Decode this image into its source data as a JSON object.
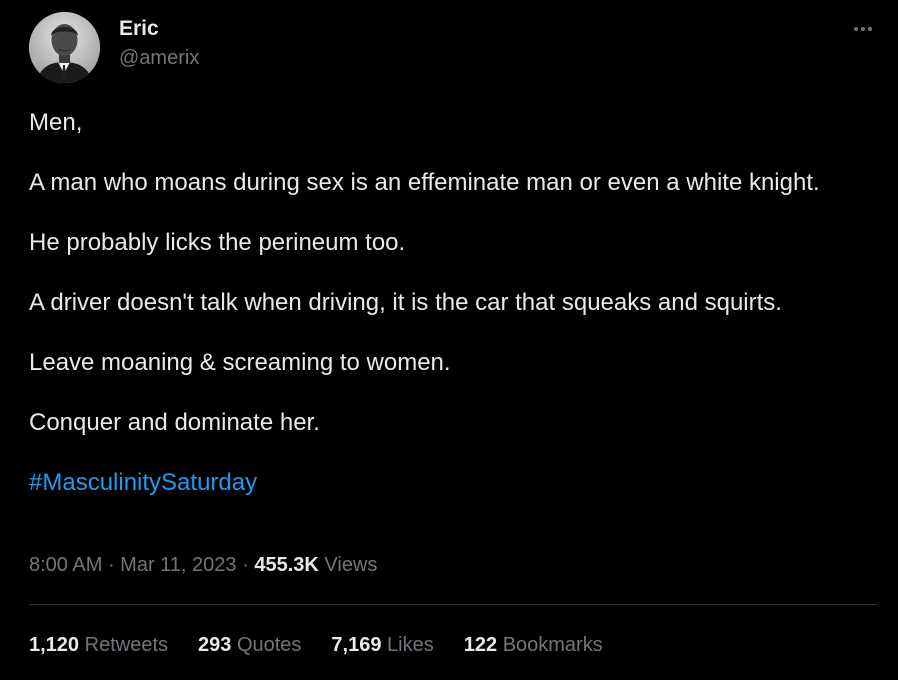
{
  "tweet": {
    "author": {
      "name": "Eric",
      "handle": "@amerix"
    },
    "paragraphs": [
      "Men,",
      "A man who moans during sex is an effeminate man or even a white knight.",
      "He probably licks the perineum too.",
      "A driver doesn't talk when driving, it is the car that squeaks and squirts.",
      "Leave moaning & screaming to women.",
      "Conquer and dominate her."
    ],
    "hashtag": "#MasculinitySaturday",
    "time": "8:00 AM",
    "separator": " · ",
    "date": "Mar 11, 2023",
    "views_count": "455.3K",
    "views_label": "Views"
  },
  "stats": [
    {
      "count": "1,120",
      "label": "Retweets"
    },
    {
      "count": "293",
      "label": "Quotes"
    },
    {
      "count": "7,169",
      "label": "Likes"
    },
    {
      "count": "122",
      "label": "Bookmarks"
    }
  ],
  "colors": {
    "background": "#000000",
    "text": "#e7e9ea",
    "secondary": "#71767b",
    "link": "#1d9bf0",
    "divider": "#2f3336"
  },
  "icons": {
    "more": "more-horizontal-icon"
  }
}
